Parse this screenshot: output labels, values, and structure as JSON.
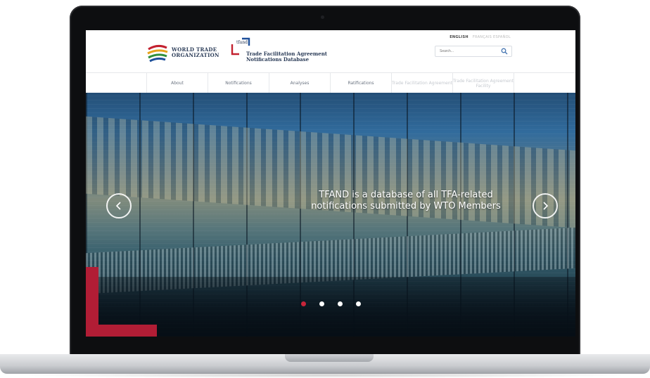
{
  "header": {
    "languages": {
      "active": "ENGLISH",
      "others": "FRANÇAIS   ESPAÑOL"
    },
    "search": {
      "placeholder": "Search..."
    },
    "wto": {
      "line1": "WORLD TRADE",
      "line2": "ORGANIZATION"
    },
    "tfand": {
      "short": "tfand",
      "line1": "Trade Facilitation Agreement",
      "line2": "Notifications Database"
    }
  },
  "nav": {
    "items": [
      {
        "label": "About"
      },
      {
        "label": "Notifications"
      },
      {
        "label": "Analyses"
      },
      {
        "label": "Ratifications"
      },
      {
        "label": "Trade Facilitation Agreement"
      },
      {
        "label": "Trade Facilitation Agreement Facility"
      }
    ]
  },
  "hero": {
    "caption_line1": "TFAND is a database of all TFA-related",
    "caption_line2": "notifications submitted by WTO Members",
    "slides_total": 4,
    "active_slide": 1
  },
  "colors": {
    "accent_red": "#b11d35",
    "brand_navy": "#2a3b57"
  }
}
